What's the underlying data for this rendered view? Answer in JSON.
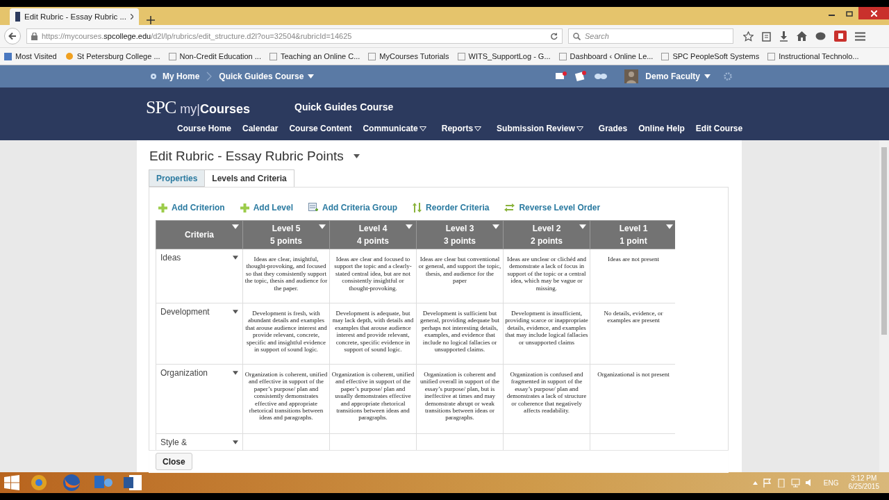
{
  "browser": {
    "tab_title": "Edit Rubric - Essay Rubric ...",
    "url_prefix": "https://mycourses.",
    "url_domain": "spcollege.edu",
    "url_rest": "/d2l/lp/rubrics/edit_structure.d2l?ou=32504&rubricId=14625",
    "search_placeholder": "Search",
    "bookmarks": [
      "Most Visited",
      "St Petersburg College ...",
      "Non-Credit Education ...",
      "Teaching an Online C...",
      "MyCourses Tutorials",
      "WITS_SupportLog - G...",
      "Dashboard ‹ Online Le...",
      "SPC PeopleSoft Systems",
      "Instructional Technolo..."
    ]
  },
  "topnav": {
    "home": "My Home",
    "course": "Quick Guides Course",
    "user": "Demo Faculty"
  },
  "header": {
    "logo": "SPC",
    "logo_my": "my",
    "logo_sep": "|",
    "logo_courses": "Courses",
    "course_title": "Quick Guides Course",
    "menu": [
      {
        "label": "Course Home",
        "dropdown": false
      },
      {
        "label": "Calendar",
        "dropdown": false
      },
      {
        "label": "Course Content",
        "dropdown": false
      },
      {
        "label": "Communicate",
        "dropdown": true
      },
      {
        "label": "Reports",
        "dropdown": true
      },
      {
        "label": "Submission Review",
        "dropdown": true
      },
      {
        "label": "Grades",
        "dropdown": false
      },
      {
        "label": "Online Help",
        "dropdown": false
      },
      {
        "label": "Edit Course",
        "dropdown": false
      }
    ]
  },
  "page_title": "Edit Rubric - Essay Rubric Points",
  "tabs": [
    {
      "label": "Properties",
      "selected": false
    },
    {
      "label": "Levels and Criteria",
      "selected": true
    }
  ],
  "actions": [
    {
      "label": "Add Criterion",
      "kind": "add"
    },
    {
      "label": "Add Level",
      "kind": "add"
    },
    {
      "label": "Add Criteria Group",
      "kind": "group"
    },
    {
      "label": "Reorder Criteria",
      "kind": "reorder"
    },
    {
      "label": "Reverse Level Order",
      "kind": "reverse"
    }
  ],
  "table": {
    "criteria_heading": "Criteria",
    "columns": [
      {
        "level": "Level 5",
        "points": "5 points"
      },
      {
        "level": "Level 4",
        "points": "4 points"
      },
      {
        "level": "Level 3",
        "points": "3 points"
      },
      {
        "level": "Level 2",
        "points": "2 points"
      },
      {
        "level": "Level 1",
        "points": "1 point"
      }
    ],
    "rows": [
      {
        "criterion": "Ideas",
        "cells": [
          "Ideas are clear, insightful, thought-provoking, and focused so that they consistently support the topic, thesis and audience for the paper.",
          "Ideas are clear and focused to support the topic and a clearly-stated central idea, but are not consistently insightful or thought-provoking.",
          "Ideas are clear but conventional or general, and support the topic, thesis, and audience for the paper",
          "Ideas are unclear or clichéd and demonstrate a lack of focus in support of the topic or a central idea, which may be vague or missing.",
          "Ideas are not present"
        ]
      },
      {
        "criterion": "Development",
        "cells": [
          "Development is fresh, with abundant details and examples that arouse audience interest and provide relevant, concrete, specific and insightful evidence in support of sound logic.",
          "Development is adequate, but may lack depth, with details and examples that arouse audience interest and provide relevant, concrete, specific evidence in support of sound logic.",
          "Development is sufficient but general, providing adequate but perhaps not interesting details, examples, and evidence that include no logical fallacies or unsupported claims.",
          "Development is insufficient, providing scarce or inappropriate details, evidence, and examples that may include logical fallacies or unsupported claims",
          "No details, evidence, or examples are present"
        ]
      },
      {
        "criterion": "Organization",
        "cells": [
          "Organization is coherent, unified and effective in support of the paper’s purpose/ plan and consistently demonstrates effective and appropriate rhetorical transitions between ideas and paragraphs.",
          "Organization is coherent, unified and effective in support of the paper’s purpose/ plan and usually demonstrates effective and appropriate rhetorical transitions between ideas and paragraphs.",
          "Organization is coherent and unified overall in support of the essay’s purpose/ plan, but is ineffective at times and may demonstrate abrupt or weak transitions between ideas or paragraphs.",
          "Organization is confused and fragmented in support of the essay’s purpose/ plan and demonstrates a lack of structure or coherence that negatively affects readability.",
          "Organizational is not present"
        ]
      },
      {
        "criterion": "Style &",
        "cells": []
      }
    ]
  },
  "close_button": "Close",
  "taskbar": {
    "language": "ENG",
    "time": "3:12 PM",
    "date": "6/25/2015"
  }
}
